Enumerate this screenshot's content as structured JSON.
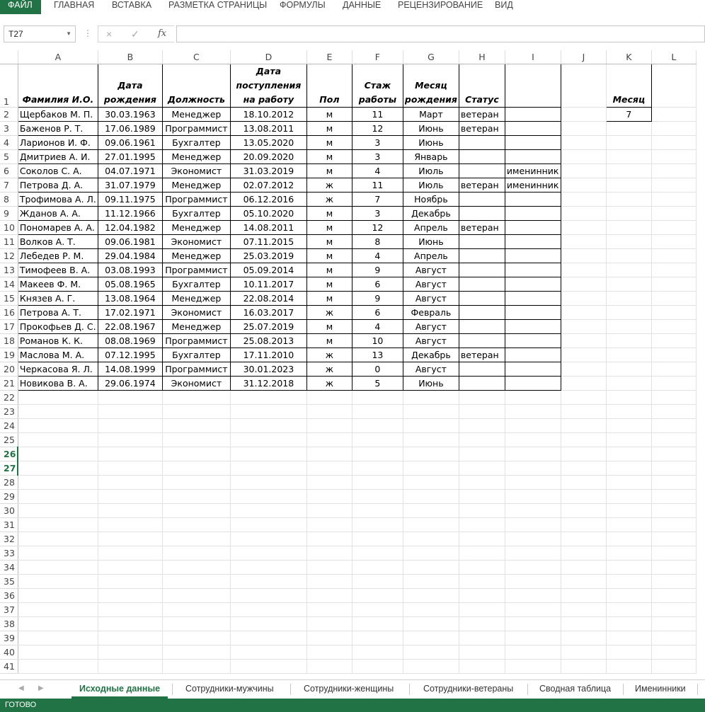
{
  "ribbon": {
    "tabs": [
      "ФАЙЛ",
      "ГЛАВНАЯ",
      "ВСТАВКА",
      "РАЗМЕТКА СТРАНИЦЫ",
      "ФОРМУЛЫ",
      "ДАННЫЕ",
      "РЕЦЕНЗИРОВАНИЕ",
      "ВИД"
    ]
  },
  "formula_bar": {
    "name_box": "T27",
    "cancel_icon": "×",
    "enter_icon": "✓",
    "fx_label": "fx",
    "formula": ""
  },
  "columns": [
    "A",
    "B",
    "C",
    "D",
    "E",
    "F",
    "G",
    "H",
    "I",
    "J",
    "K",
    "L"
  ],
  "headers": {
    "A": "Фамилия И.О.",
    "B": "Дата рождения",
    "C": "Должность",
    "D": "Дата поступления на работу",
    "E": "Пол",
    "F": "Стаж работы",
    "G": "Месяц рождения",
    "H": "Статус",
    "I": "",
    "K": "Месяц"
  },
  "side_value": {
    "K2": "7"
  },
  "rows": [
    [
      "Щербаков М. П.",
      "30.03.1963",
      "Менеджер",
      "18.10.2012",
      "м",
      "11",
      "Март",
      "ветеран",
      ""
    ],
    [
      "Баженов Р. Т.",
      "17.06.1989",
      "Программист",
      "13.08.2011",
      "м",
      "12",
      "Июнь",
      "ветеран",
      ""
    ],
    [
      "Ларионов И. Ф.",
      "09.06.1961",
      "Бухгалтер",
      "13.05.2020",
      "м",
      "3",
      "Июнь",
      "",
      ""
    ],
    [
      "Дмитриев А. И.",
      "27.01.1995",
      "Менеджер",
      "20.09.2020",
      "м",
      "3",
      "Январь",
      "",
      ""
    ],
    [
      "Соколов С. А.",
      "04.07.1971",
      "Экономист",
      "31.03.2019",
      "м",
      "4",
      "Июль",
      "",
      "именинник"
    ],
    [
      "Петрова Д. А.",
      "31.07.1979",
      "Менеджер",
      "02.07.2012",
      "ж",
      "11",
      "Июль",
      "ветеран",
      "именинник"
    ],
    [
      "Трофимова А. Л.",
      "09.11.1975",
      "Программист",
      "06.12.2016",
      "ж",
      "7",
      "Ноябрь",
      "",
      ""
    ],
    [
      "Жданов А. А.",
      "11.12.1966",
      "Бухгалтер",
      "05.10.2020",
      "м",
      "3",
      "Декабрь",
      "",
      ""
    ],
    [
      "Пономарев А. А.",
      "12.04.1982",
      "Менеджер",
      "14.08.2011",
      "м",
      "12",
      "Апрель",
      "ветеран",
      ""
    ],
    [
      "Волков А. Т.",
      "09.06.1981",
      "Экономист",
      "07.11.2015",
      "м",
      "8",
      "Июнь",
      "",
      ""
    ],
    [
      "Лебедев Р. М.",
      "29.04.1984",
      "Менеджер",
      "25.03.2019",
      "м",
      "4",
      "Апрель",
      "",
      ""
    ],
    [
      "Тимофеев В. А.",
      "03.08.1993",
      "Программист",
      "05.09.2014",
      "м",
      "9",
      "Август",
      "",
      ""
    ],
    [
      "Макеев Ф. М.",
      "05.08.1965",
      "Бухгалтер",
      "10.11.2017",
      "м",
      "6",
      "Август",
      "",
      ""
    ],
    [
      "Князев А. Г.",
      "13.08.1964",
      "Менеджер",
      "22.08.2014",
      "м",
      "9",
      "Август",
      "",
      ""
    ],
    [
      "Петрова А. Т.",
      "17.02.1971",
      "Экономист",
      "16.03.2017",
      "ж",
      "6",
      "Февраль",
      "",
      ""
    ],
    [
      "Прокофьев Д. С.",
      "22.08.1967",
      "Менеджер",
      "25.07.2019",
      "м",
      "4",
      "Август",
      "",
      ""
    ],
    [
      "Романов К. К.",
      "08.08.1969",
      "Программист",
      "25.08.2013",
      "м",
      "10",
      "Август",
      "",
      ""
    ],
    [
      "Маслова М. А.",
      "07.12.1995",
      "Бухгалтер",
      "17.11.2010",
      "ж",
      "13",
      "Декабрь",
      "ветеран",
      ""
    ],
    [
      "Черкасова Я. Л.",
      "14.08.1999",
      "Программист",
      "30.01.2023",
      "ж",
      "0",
      "Август",
      "",
      ""
    ],
    [
      "Новикова В. А.",
      "29.06.1974",
      "Экономист",
      "31.12.2018",
      "ж",
      "5",
      "Июнь",
      "",
      ""
    ]
  ],
  "row_numbers": [
    "1",
    "2",
    "3",
    "4",
    "5",
    "6",
    "7",
    "8",
    "9",
    "10",
    "11",
    "12",
    "13",
    "14",
    "15",
    "16",
    "17",
    "18",
    "19",
    "20",
    "21",
    "22",
    "23",
    "24",
    "25",
    "26",
    "27",
    "28",
    "29",
    "30",
    "31",
    "32",
    "33",
    "34",
    "35",
    "36",
    "37",
    "38",
    "39",
    "40",
    "41"
  ],
  "sheets": [
    "Исходные данные",
    "Сотрудники-мужчины",
    "Сотрудники-женщины",
    "Сотрудники-ветераны",
    "Сводная таблица",
    "Именинники"
  ],
  "active_sheet": "Исходные данные",
  "status_text": "ГОТОВО",
  "accent_color": "#217346"
}
